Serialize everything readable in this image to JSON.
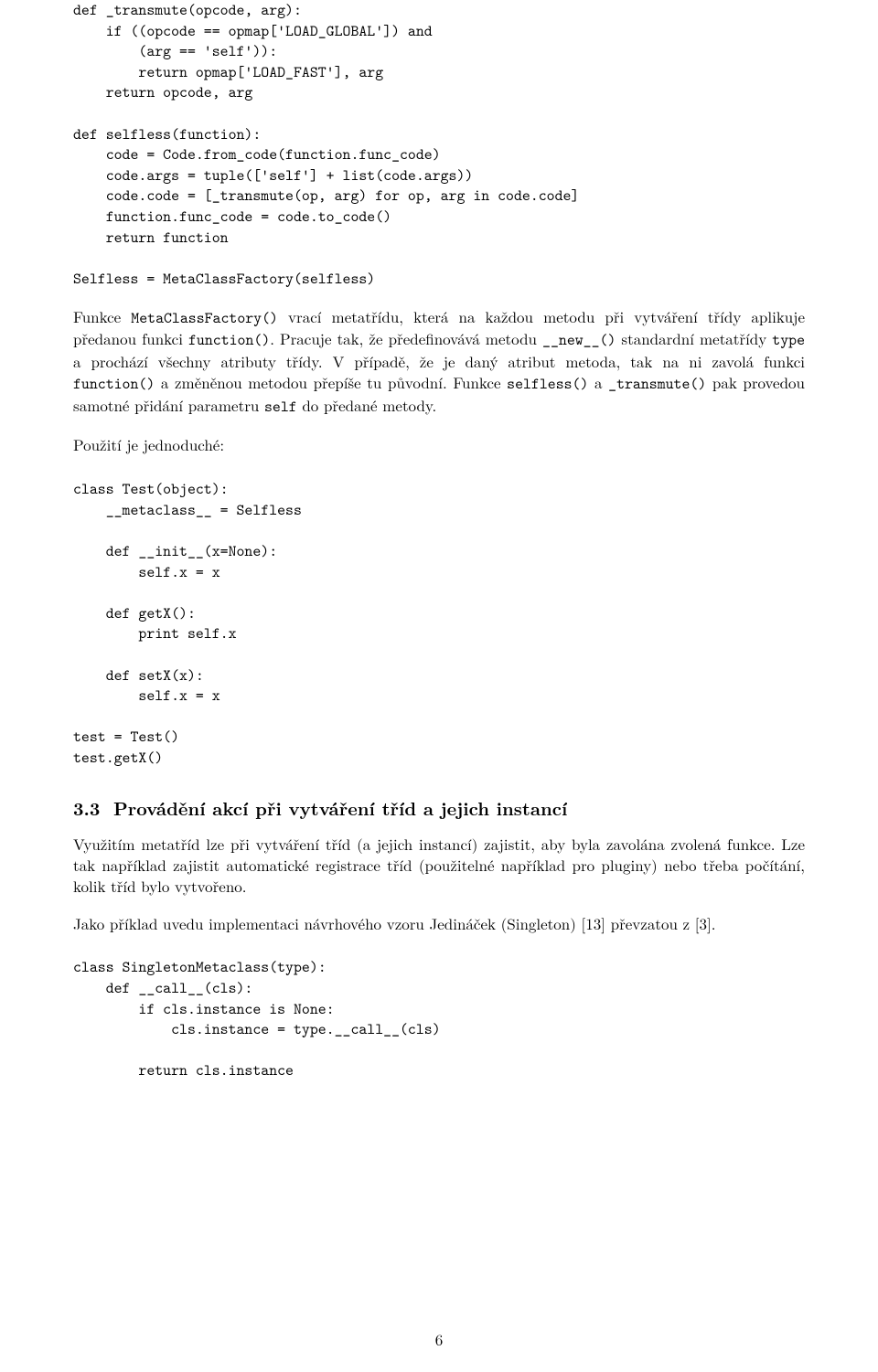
{
  "code1": "def _transmute(opcode, arg):\n    if ((opcode == opmap['LOAD_GLOBAL']) and\n        (arg == 'self')):\n        return opmap['LOAD_FAST'], arg\n    return opcode, arg\n\ndef selfless(function):\n    code = Code.from_code(function.func_code)\n    code.args = tuple(['self'] + list(code.args))\n    code.code = [_transmute(op, arg) for op, arg in code.code]\n    function.func_code = code.to_code()\n    return function\n\nSelfless = MetaClassFactory(selfless)",
  "para1_pre": "Funkce ",
  "para1_tt1": "MetaClassFactory()",
  "para1_mid1": " vrací metatřídu, která na každou metodu při vytváření třídy aplikuje předanou funkci ",
  "para1_tt2": "function()",
  "para1_mid2": ". Pracuje tak, že předefinovává metodu ",
  "para1_tt3": "__new__()",
  "para1_mid3": " standardní metatřídy ",
  "para1_tt4": "type",
  "para1_mid4": " a prochází všechny atributy třídy. V případě, že je daný atribut metoda, tak na ni zavolá funkci ",
  "para1_tt5": "function()",
  "para1_mid5": " a změněnou metodou přepíše tu původní. Funkce ",
  "para1_tt6": "selfless()",
  "para1_mid6": " a ",
  "para1_tt7": "_transmute()",
  "para1_mid7": " pak provedou samotné přidání parametru ",
  "para1_tt8": "self",
  "para1_mid8": " do předané metody.",
  "para2": "Použití je jednoduché:",
  "code2": "class Test(object):\n    __metaclass__ = Selfless\n\n    def __init__(x=None):\n        self.x = x\n\n    def getX():\n        print self.x\n\n    def setX(x):\n        self.x = x\n\ntest = Test()\ntest.getX()",
  "section_number": "3.3",
  "section_title": "Provádění akcí při vytváření tříd a jejich instancí",
  "para3": "Využitím metatříd lze při vytváření tříd (a jejich instancí) zajistit, aby byla zavolána zvolená funkce. Lze tak například zajistit automatické registrace tříd (použitelné například pro pluginy) nebo třeba počítání, kolik tříd bylo vytvořeno.",
  "para4": "Jako příklad uvedu implementaci návrhového vzoru Jedináček (Singleton) [13] převzatou z [3].",
  "code3": "class SingletonMetaclass(type):\n    def __call__(cls):\n        if cls.instance is None:\n            cls.instance = type.__call__(cls)\n\n        return cls.instance",
  "page_number": "6"
}
